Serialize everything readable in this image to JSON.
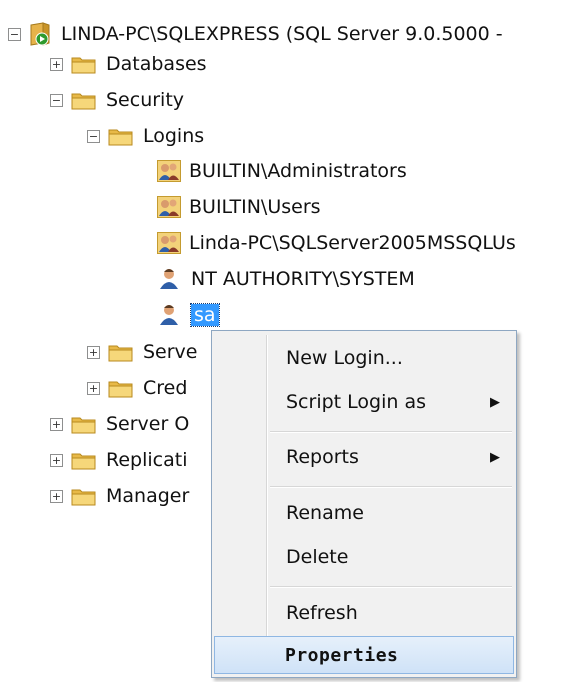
{
  "tree": {
    "server": "LINDA-PC\\SQLEXPRESS (SQL Server 9.0.5000 -",
    "databases": "Databases",
    "security": "Security",
    "logins": "Logins",
    "login_items": [
      "BUILTIN\\Administrators",
      "BUILTIN\\Users",
      "Linda-PC\\SQLServer2005MSSQLUs",
      "NT AUTHORITY\\SYSTEM",
      "sa"
    ],
    "server_roles": "Serve",
    "credentials": "Cred",
    "server_objects": "Server O",
    "replication": "Replicati",
    "management": "Manager",
    "expanded_glyph": "−",
    "collapsed_glyph": "+"
  },
  "context_menu": {
    "items": [
      {
        "label": "New Login..."
      },
      {
        "label": "Script Login as",
        "submenu_arrow": "▶"
      },
      {
        "label": "Reports",
        "submenu_arrow": "▶"
      },
      {
        "label": "Rename"
      },
      {
        "label": "Delete"
      },
      {
        "label": "Refresh"
      },
      {
        "label": "Properties",
        "highlighted": true
      }
    ]
  },
  "colors": {
    "selection": "#3399ff",
    "folder": "#f2c95c",
    "server_badge": "#2e9a2e",
    "menu_highlight": "#cfe2f7"
  },
  "icons": {
    "folder": "folder-icon",
    "group_login": "group-login-icon",
    "user_login": "user-login-icon",
    "server": "server-icon"
  }
}
